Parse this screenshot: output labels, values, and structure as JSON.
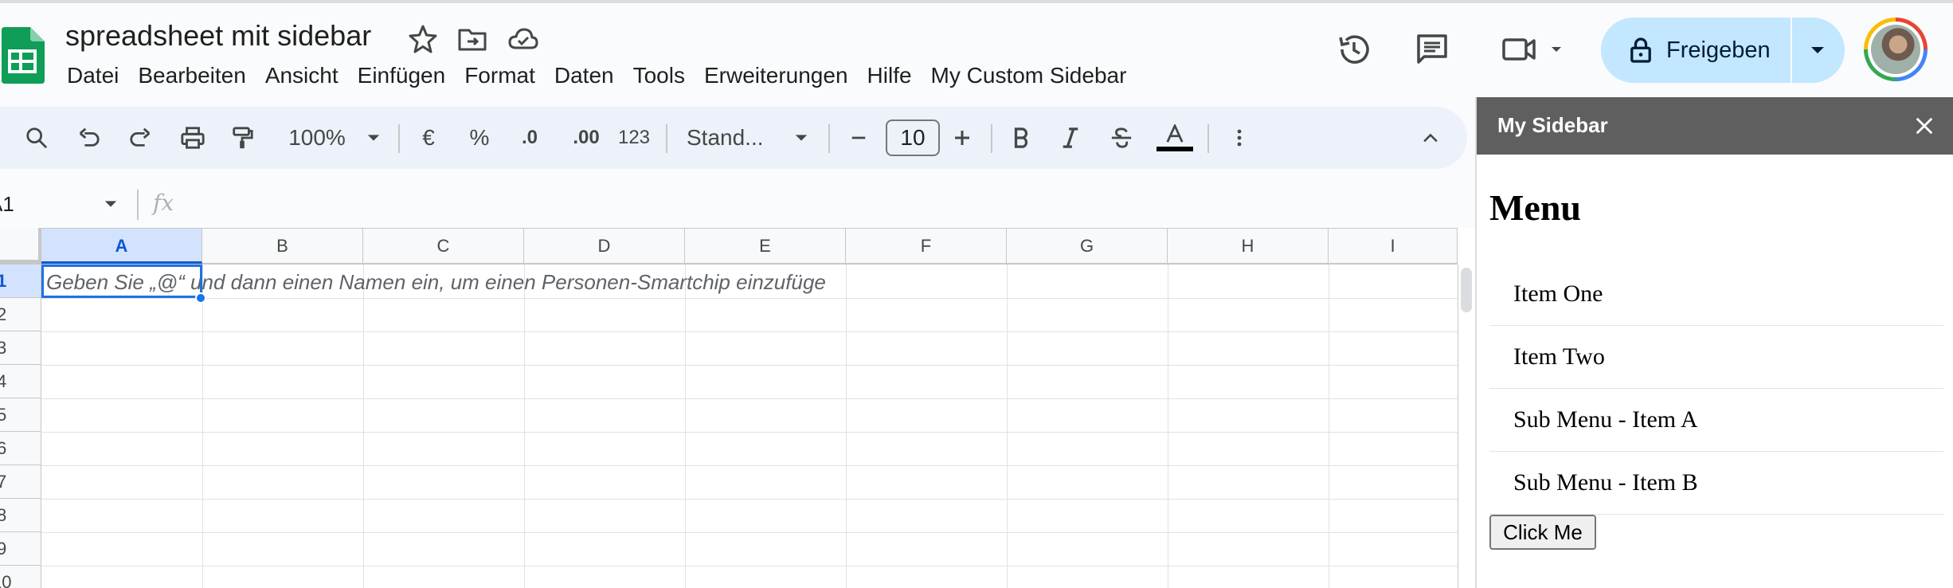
{
  "document": {
    "title": "spreadsheet mit sidebar"
  },
  "menu": [
    {
      "label": "Datei"
    },
    {
      "label": "Bearbeiten"
    },
    {
      "label": "Ansicht"
    },
    {
      "label": "Einfügen"
    },
    {
      "label": "Format"
    },
    {
      "label": "Daten"
    },
    {
      "label": "Tools"
    },
    {
      "label": "Erweiterungen"
    },
    {
      "label": "Hilfe"
    },
    {
      "label": "My Custom Sidebar"
    }
  ],
  "header": {
    "share_label": "Freigeben"
  },
  "toolbar": {
    "zoom": "100%",
    "currency": "€",
    "percent": "%",
    "dec_decrease": ".0",
    "dec_increase": ".00",
    "number_format": "123",
    "font": "Stand...",
    "font_size": "10"
  },
  "formula_bar": {
    "name_box": "A1",
    "fx": "fx"
  },
  "grid": {
    "columns": [
      "A",
      "B",
      "C",
      "D",
      "E",
      "F",
      "G",
      "H",
      "I"
    ],
    "rows": [
      "1",
      "2",
      "3",
      "4",
      "5",
      "6",
      "7",
      "8",
      "9",
      "10"
    ],
    "selected_cell": "A1",
    "a1_hint": "Geben Sie „@“ und dann einen Namen ein, um einen Personen-Smartchip einzufüge"
  },
  "sidebar": {
    "title": "My Sidebar",
    "heading": "Menu",
    "items": [
      {
        "label": "Item One"
      },
      {
        "label": "Item Two"
      },
      {
        "label": "Sub Menu - Item A"
      },
      {
        "label": "Sub Menu - Item B"
      }
    ],
    "button_label": "Click Me"
  },
  "colors": {
    "accent": "#0b57d0",
    "share_bg": "#c2e7ff",
    "toolbar_bg": "#edf2fa",
    "sidebar_header": "#5f5f5f",
    "sheets_green": "#0f9d58"
  }
}
